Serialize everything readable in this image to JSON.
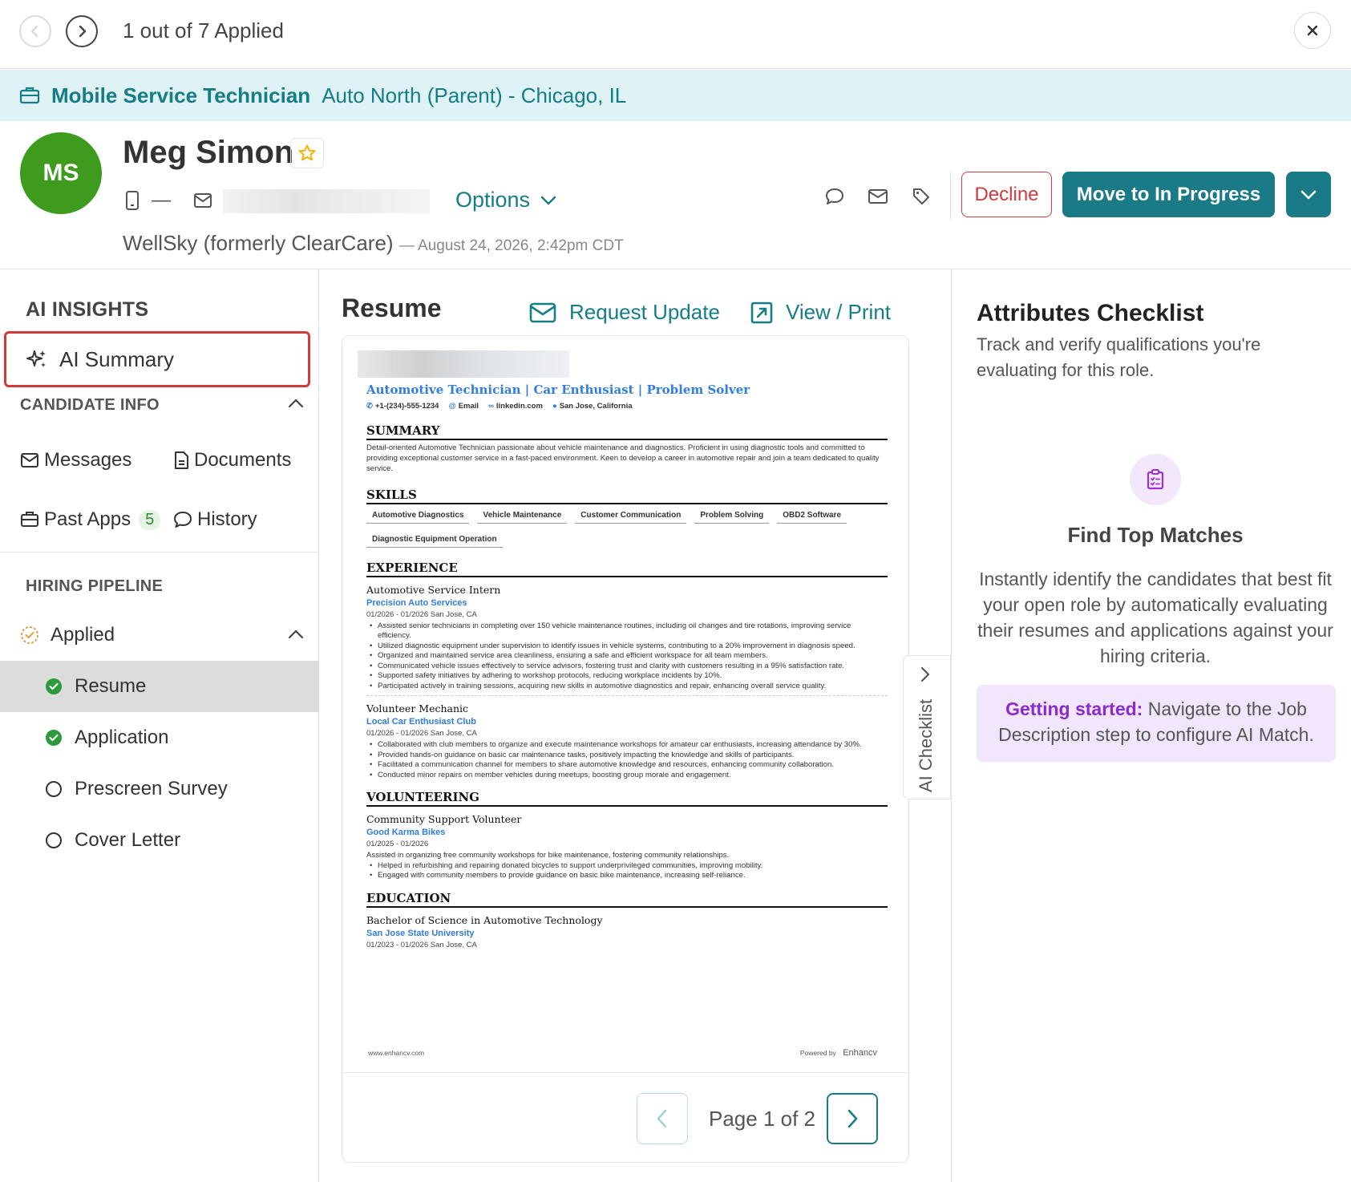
{
  "topbar": {
    "count_label": "1 out of 7 Applied"
  },
  "job": {
    "title": "Mobile Service Technician",
    "location": "Auto North (Parent) - Chicago, IL"
  },
  "candidate": {
    "initials": "MS",
    "name": "Meg Simon",
    "phone": "—",
    "email_prefix": "r",
    "options_label": "Options",
    "source": "WellSky (formerly ClearCare)",
    "applied_at": "— August 24, 2026, 2:42pm CDT",
    "avatar_color": "#3f9b1e"
  },
  "actions": {
    "decline": "Decline",
    "move": "Move to In Progress"
  },
  "sidebar": {
    "ai_insights": "AI INSIGHTS",
    "ai_summary": "AI Summary",
    "candidate_info": "CANDIDATE INFO",
    "messages": "Messages",
    "documents": "Documents",
    "past_apps": "Past Apps",
    "past_apps_count": "5",
    "history": "History",
    "hiring_pipeline": "HIRING PIPELINE",
    "applied": "Applied",
    "steps": [
      "Resume",
      "Application",
      "Prescreen Survey",
      "Cover Letter"
    ]
  },
  "resume_panel": {
    "title": "Resume",
    "request_update": "Request Update",
    "view_print": "View / Print",
    "page_label": "Page 1 of 2"
  },
  "resume": {
    "headline": "Automotive Technician | Car Enthusiast | Problem Solver",
    "phone": "+1-(234)-555-1234",
    "email": "Email",
    "linkedin": "linkedin.com",
    "location": "San Jose, California",
    "summary_title": "SUMMARY",
    "summary": "Detail-oriented Automotive Technician passionate about vehicle maintenance and diagnostics. Proficient in using diagnostic tools and committed to providing exceptional customer service in a fast-paced environment. Keen to develop a career in automotive repair and join a team dedicated to quality service.",
    "skills_title": "SKILLS",
    "skills": [
      "Automotive Diagnostics",
      "Vehicle Maintenance",
      "Customer Communication",
      "Problem Solving",
      "OBD2 Software",
      "Diagnostic Equipment Operation"
    ],
    "experience_title": "EXPERIENCE",
    "exp1": {
      "role": "Automotive Service Intern",
      "org": "Precision Auto Services",
      "meta": "01/2026 - 01/2026     San Jose, CA",
      "bullets": [
        "Assisted senior technicians in completing over 150 vehicle maintenance routines, including oil changes and tire rotations, improving service efficiency.",
        "Utilized diagnostic equipment under supervision to identify issues in vehicle systems, contributing to a 20% improvement in diagnosis speed.",
        "Organized and maintained service area cleanliness, ensuring a safe and efficient workspace for all team members.",
        "Communicated vehicle issues effectively to service advisors, fostering trust and clarity with customers resulting in a 95% satisfaction rate.",
        "Supported safety initiatives by adhering to workshop protocols, reducing workplace incidents by 10%.",
        "Participated actively in training sessions, acquiring new skills in automotive diagnostics and repair, enhancing overall service quality."
      ]
    },
    "exp2": {
      "role": "Volunteer Mechanic",
      "org": "Local Car Enthusiast Club",
      "meta": "01/2026 - 01/2026     San Jose, CA",
      "bullets": [
        "Collaborated with club members to organize and execute maintenance workshops for amateur car enthusiasts, increasing attendance by 30%.",
        "Provided hands-on guidance on basic car maintenance tasks, positively impacting the knowledge and skills of participants.",
        "Facilitated a communication channel for members to share automotive knowledge and resources, enhancing community collaboration.",
        "Conducted minor repairs on member vehicles during meetups, boosting group morale and engagement."
      ]
    },
    "volunteering_title": "VOLUNTEERING",
    "vol": {
      "role": "Community Support Volunteer",
      "org": "Good Karma Bikes",
      "meta": "01/2025 - 01/2026",
      "desc": "Assisted in organizing free community workshops for bike maintenance, fostering community relationships.",
      "bullets": [
        "Helped in refurbishing and repairing donated bicycles to support underprivileged communities, improving mobility.",
        "Engaged with community members to provide guidance on basic bike maintenance, increasing self-reliance."
      ]
    },
    "education_title": "EDUCATION",
    "edu": {
      "degree": "Bachelor of Science in Automotive Technology",
      "school": "San Jose State University",
      "meta": "01/2023 - 01/2026     San Jose, CA"
    },
    "footer_site": "www.enhancv.com",
    "footer_powered": "Powered by",
    "footer_brand": "Enhancv"
  },
  "ai_checklist_tab": "AI Checklist",
  "checklist": {
    "title": "Attributes Checklist",
    "subtitle": "Track and verify qualifications you're evaluating for this role.",
    "heading": "Find Top Matches",
    "body": "Instantly identify the candidates that best fit your open role by automatically evaluating their resumes and applications against your hiring criteria.",
    "callout_bold": "Getting started:",
    "callout_text": " Navigate to the Job Description step to configure AI Match."
  },
  "colors": {
    "accent": "#147d86",
    "primary_button": "#1a7b87",
    "decline": "#d0393e",
    "highlight_border": "#d33b3b",
    "callout_bg": "#f1e6fb"
  },
  "icons": [
    "chevron-left-icon",
    "chevron-right-icon",
    "close-icon",
    "briefcase-icon",
    "star-icon",
    "phone-icon",
    "mail-icon",
    "chevron-down-icon",
    "comment-icon",
    "tag-icon",
    "sparkle-icon",
    "chevron-up-icon",
    "document-icon",
    "history-icon",
    "check-circle-icon",
    "empty-circle-icon",
    "external-link-icon",
    "clipboard-icon"
  ]
}
